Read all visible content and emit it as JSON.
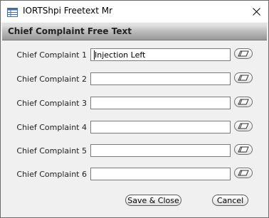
{
  "window": {
    "title": "IORTShpi Freetext Mr",
    "close_glyph": "✕"
  },
  "header": {
    "title": "Chief Complaint Free Text"
  },
  "complaints": [
    {
      "label": "Chief Complaint 1",
      "value": "Injection Left"
    },
    {
      "label": "Chief Complaint 2",
      "value": ""
    },
    {
      "label": "Chief Complaint 3",
      "value": ""
    },
    {
      "label": "Chief Complaint 4",
      "value": ""
    },
    {
      "label": "Chief Complaint 5",
      "value": ""
    },
    {
      "label": "Chief Complaint 6",
      "value": ""
    }
  ],
  "buttons": {
    "save_close": "Save & Close",
    "cancel": "Cancel"
  }
}
